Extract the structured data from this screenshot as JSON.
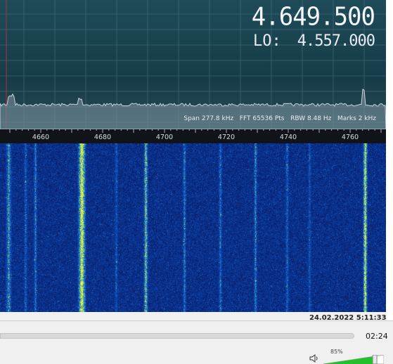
{
  "display": {
    "frequency": "4.649.500",
    "lo_label": "LO:",
    "lo_value": "4.557.000"
  },
  "status": {
    "span": "Span 277.8 kHz",
    "fft": "FFT 65536 Pts",
    "rbw": "RBW 8.48 Hz",
    "marks": "Marks 2 kHz"
  },
  "axis": {
    "ticks": [
      "4660",
      "4680",
      "4700",
      "4720",
      "4740",
      "4760"
    ]
  },
  "waterfall": {
    "timestamp": "24.02.2022 5:11:33"
  },
  "player": {
    "time": "02:24",
    "volume_label": "85%",
    "volume": 0.85
  },
  "colors": {
    "spectrum_bg": "#1e4b58",
    "waterfall_bg": "#0a1a6a",
    "volume_fill": "#22c02a"
  }
}
